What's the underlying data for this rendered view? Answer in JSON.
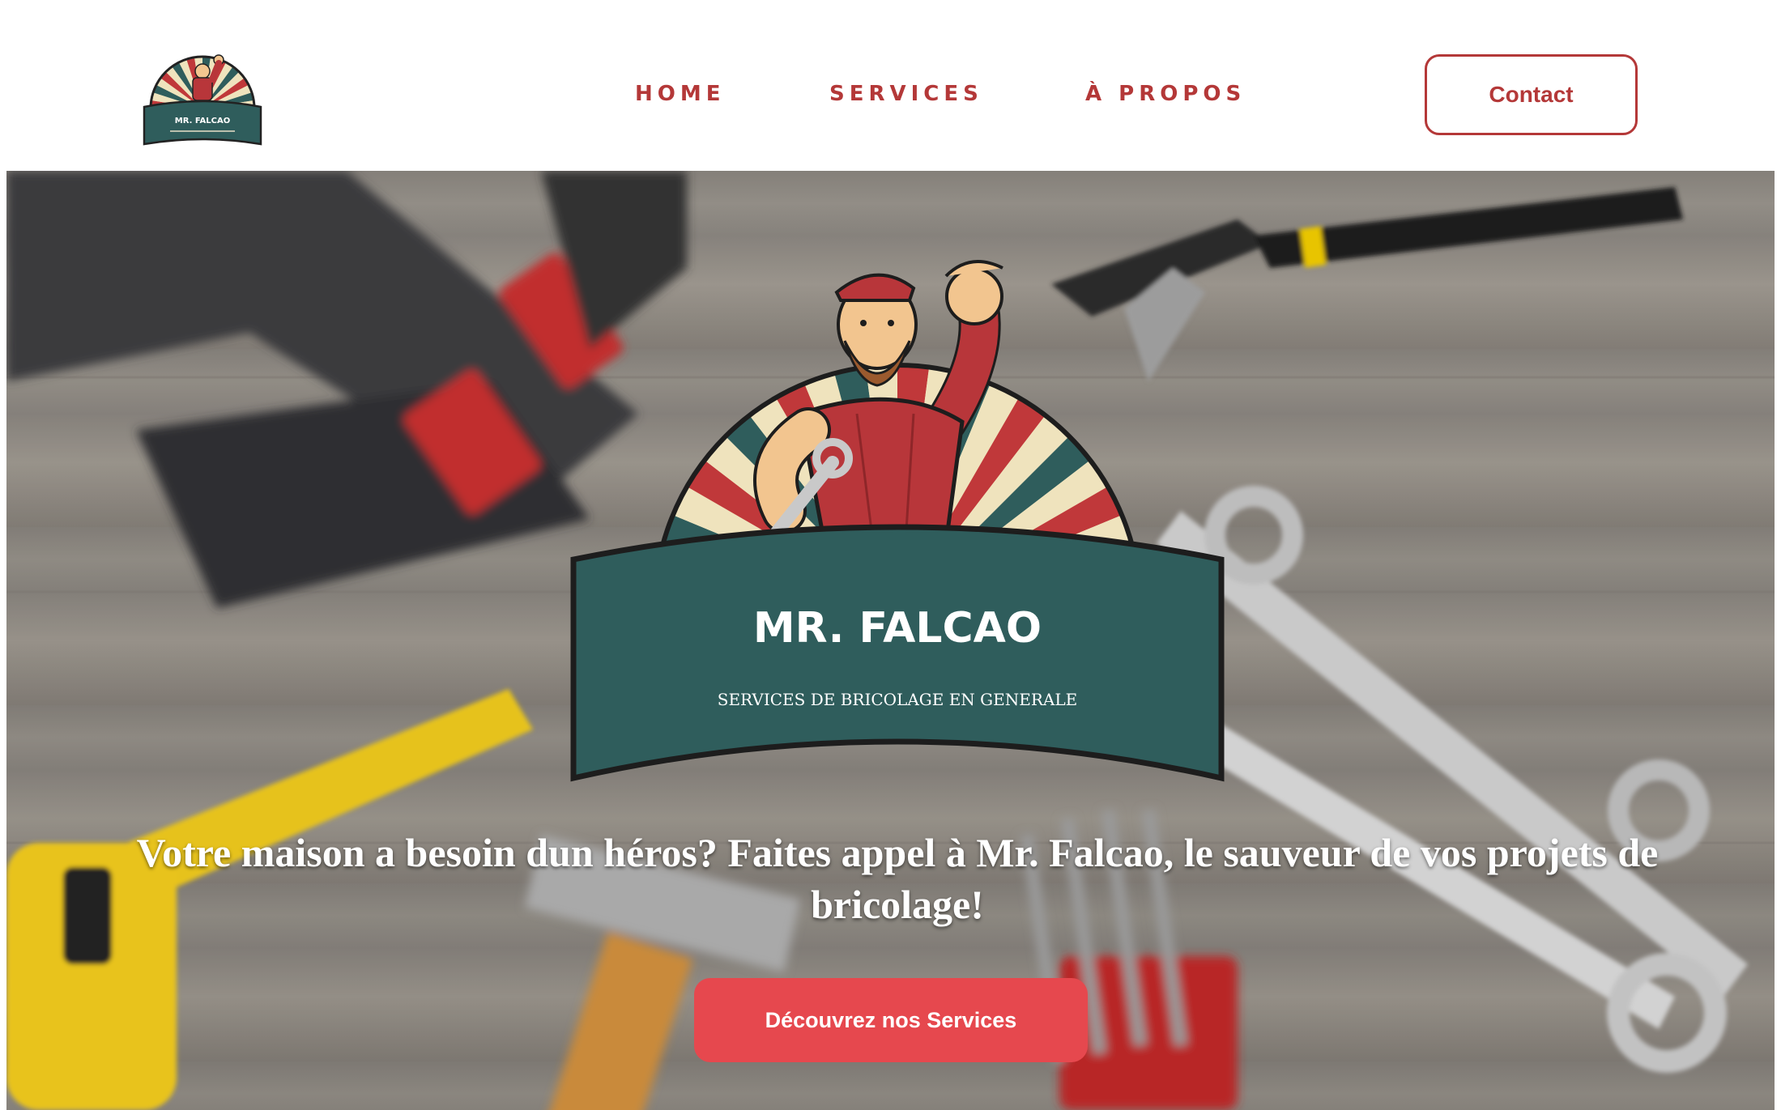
{
  "brand": {
    "name": "MR. FALCAO",
    "tagline": "SERVICES DE BRICOLAGE EN GENERALE"
  },
  "nav": {
    "items": [
      {
        "label": "HOME"
      },
      {
        "label": "SERVICES"
      },
      {
        "label": "À PROPOS"
      }
    ],
    "contact_label": "Contact"
  },
  "hero": {
    "headline": "Votre maison a besoin dun héros? Faites appel à Mr. Falcao, le sauveur de vos projets de bricolage!",
    "cta_label": "Découvrez nos Services"
  },
  "colors": {
    "accent": "#b43838",
    "cta": "#e6484e",
    "banner_teal": "#2f5d5c",
    "ray_red": "#c0383a",
    "ray_cream": "#efe3bd"
  },
  "icons": {
    "logo": "handyman-mascot-logo",
    "hero_logo": "handyman-mascot-logo"
  }
}
